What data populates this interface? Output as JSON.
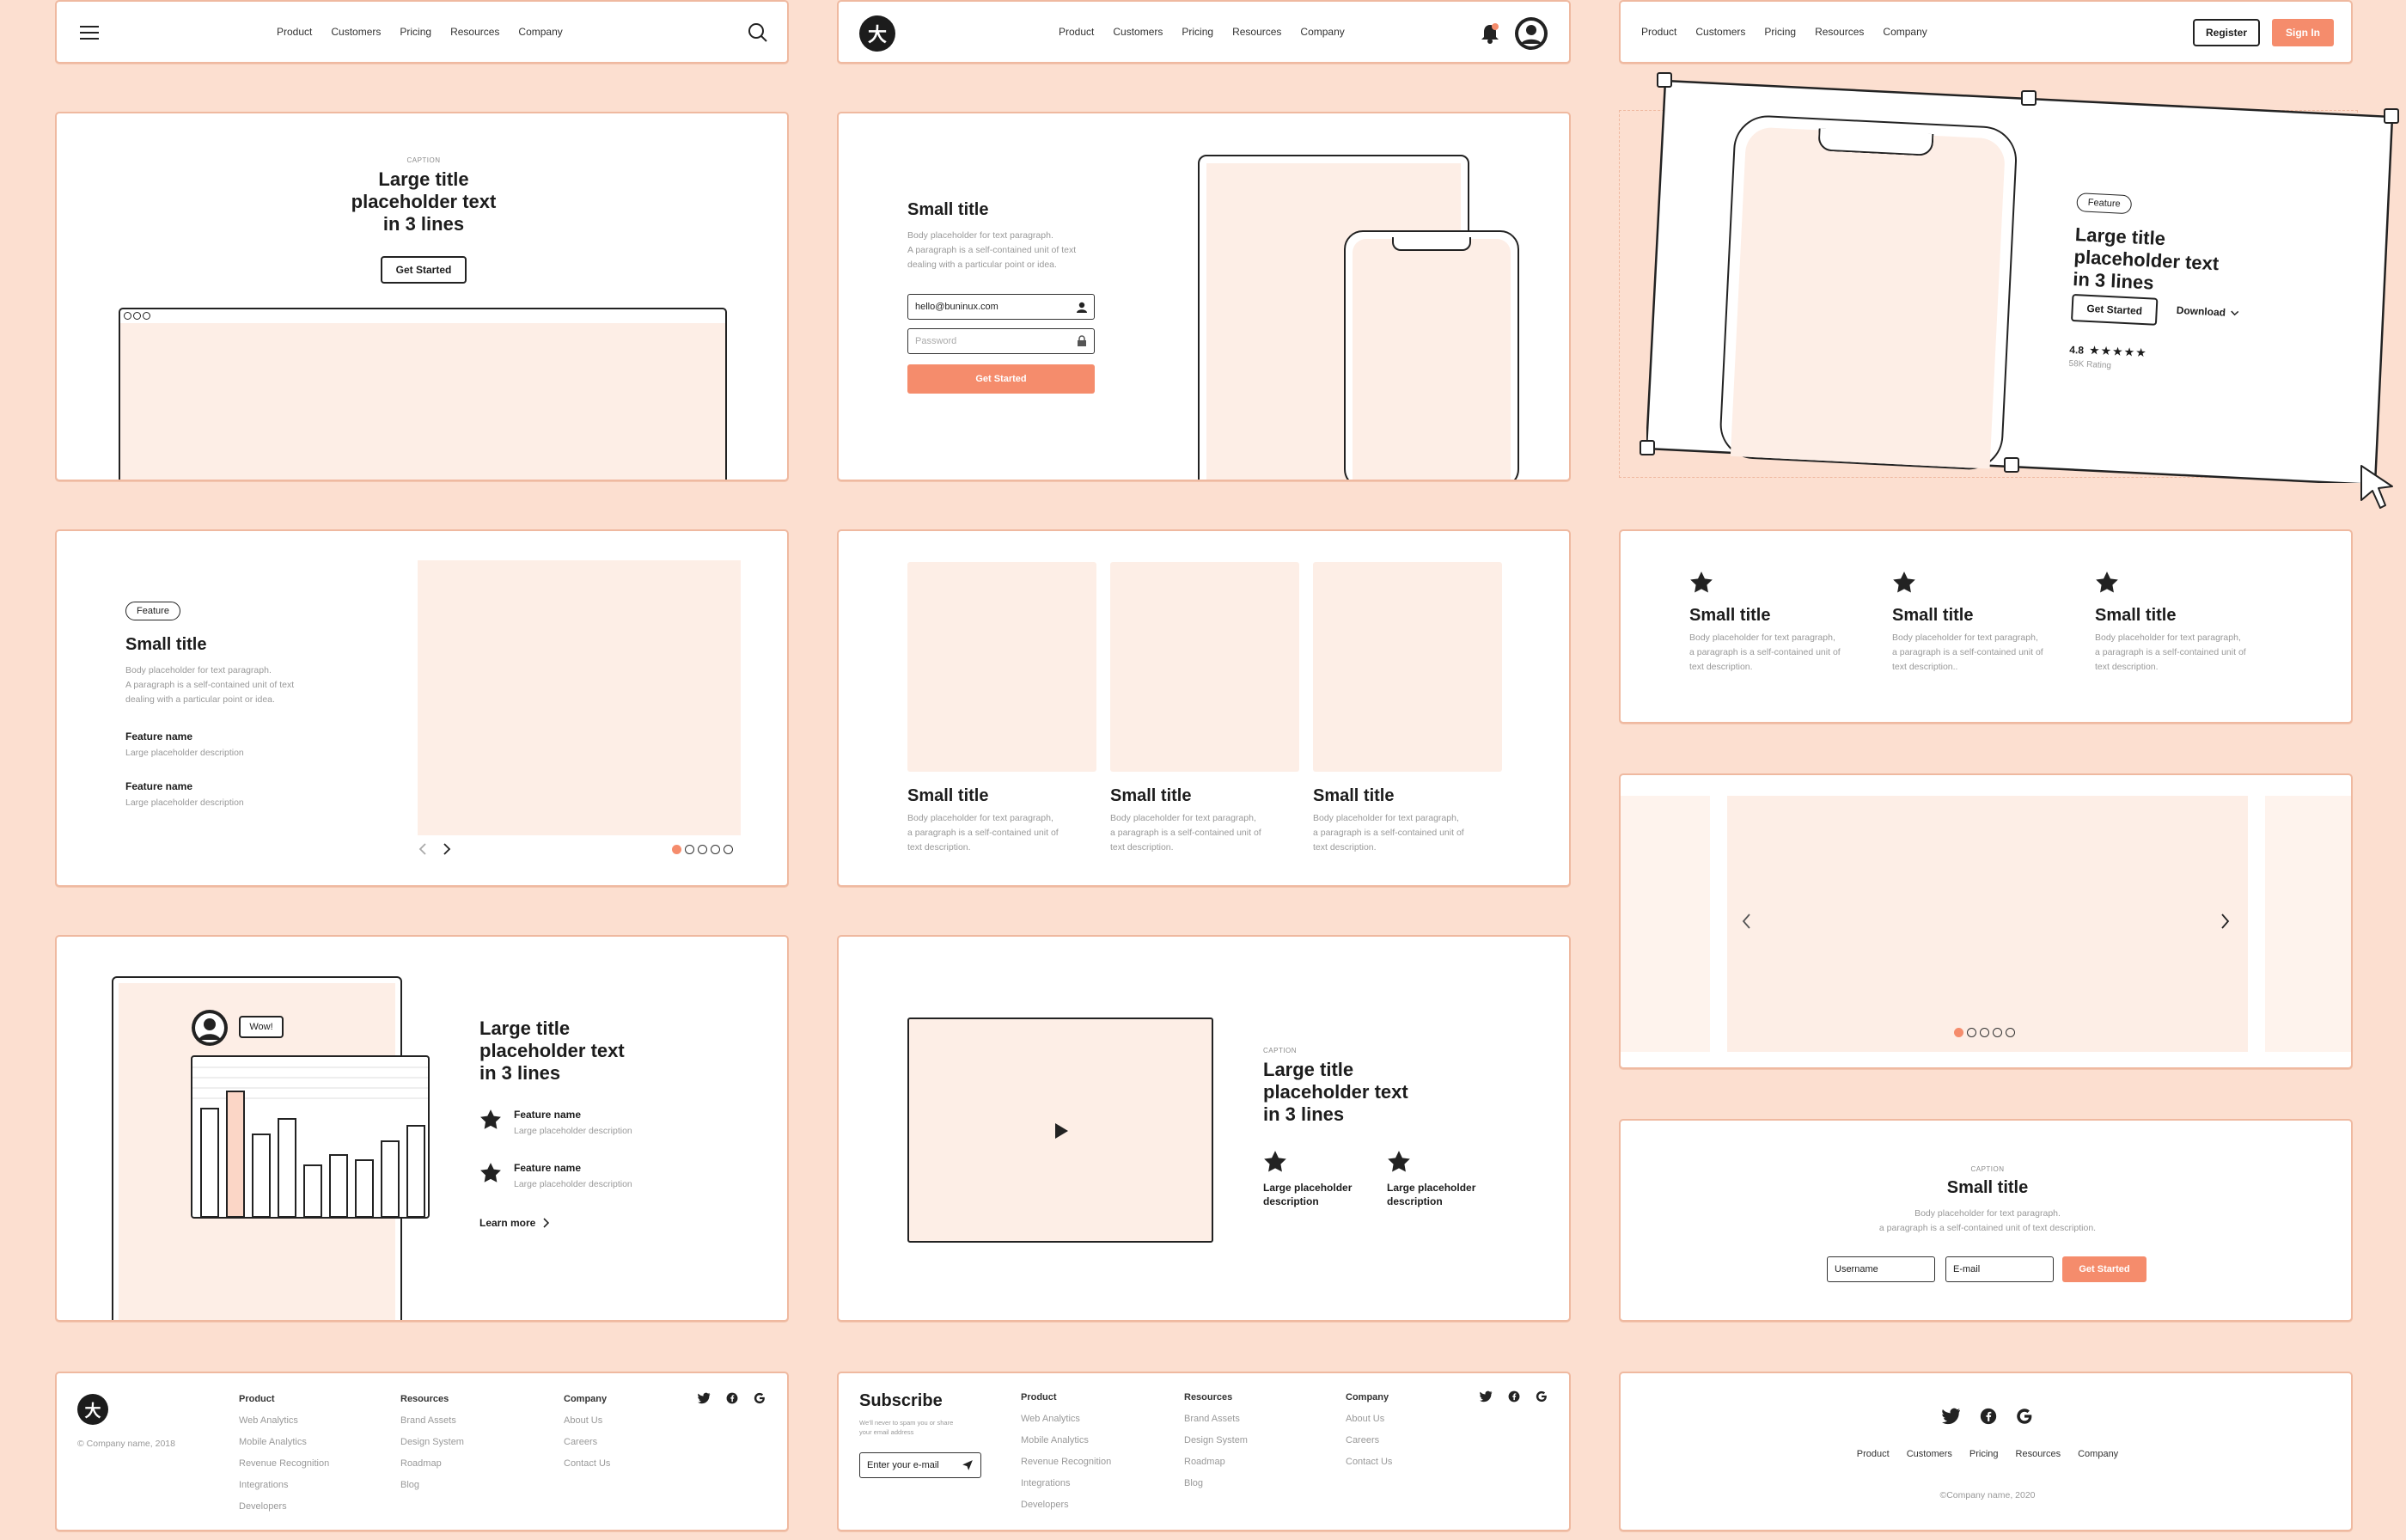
{
  "nav": {
    "links": [
      "Product",
      "Customers",
      "Pricing",
      "Resources",
      "Company"
    ],
    "register": "Register",
    "signin": "Sign In"
  },
  "hero1": {
    "caption": "CAPTION",
    "title": [
      "Large title",
      "placeholder text",
      "in 3 lines"
    ],
    "button": "Get Started"
  },
  "hero2": {
    "title": "Small title",
    "body": [
      "Body placeholder for text paragraph.",
      "A paragraph is a self-contained unit of text",
      "dealing with a particular point or idea."
    ],
    "email": "hello@buninux.com",
    "password_placeholder": "Password",
    "button": "Get Started"
  },
  "hero3": {
    "badge": "Feature",
    "title": [
      "Large title",
      "placeholder text",
      "in 3 lines"
    ],
    "button": "Get Started",
    "download": "Download",
    "rating": "4.8",
    "rating_label": "58K Rating",
    "stars": 5
  },
  "feat1": {
    "badge": "Feature",
    "title": "Small title",
    "body": [
      "Body placeholder for text paragraph.",
      "A paragraph is a self-contained unit of text",
      "dealing with a particular point or idea."
    ],
    "items": [
      {
        "name": "Feature name",
        "desc": "Large placeholder description"
      },
      {
        "name": "Feature name",
        "desc": "Large placeholder description"
      }
    ]
  },
  "cards3": {
    "items": [
      {
        "title": "Small title",
        "body": [
          "Body placeholder for text paragraph,",
          "a paragraph is a self-contained unit of",
          "text description."
        ]
      },
      {
        "title": "Small title",
        "body": [
          "Body placeholder for text paragraph,",
          "a paragraph is a self-contained unit of",
          "text description."
        ]
      },
      {
        "title": "Small title",
        "body": [
          "Body placeholder for text paragraph,",
          "a paragraph is a self-contained unit of",
          "text description."
        ]
      }
    ]
  },
  "icons3": {
    "items": [
      {
        "title": "Small title",
        "body": [
          "Body placeholder for text paragraph,",
          "a paragraph is a self-contained unit of",
          "text description."
        ]
      },
      {
        "title": "Small title",
        "body": [
          "Body placeholder for text paragraph,",
          "a paragraph is a self-contained unit of",
          "text description.."
        ]
      },
      {
        "title": "Small title",
        "body": [
          "Body placeholder for text paragraph,",
          "a paragraph is a self-contained unit of",
          "text description."
        ]
      }
    ]
  },
  "chartcard": {
    "bubble": "Wow!",
    "title": [
      "Large title",
      "placeholder text",
      "in 3 lines"
    ],
    "items": [
      {
        "name": "Feature name",
        "desc": "Large placeholder description"
      },
      {
        "name": "Feature name",
        "desc": "Large placeholder description"
      }
    ],
    "learn": "Learn more"
  },
  "videocard": {
    "caption": "CAPTION",
    "title": [
      "Large title",
      "placeholder text",
      "in 3 lines"
    ],
    "items": [
      [
        "Large placeholder",
        "description"
      ],
      [
        "Large placeholder",
        "description"
      ]
    ]
  },
  "signup": {
    "caption": "CAPTION",
    "title": "Small title",
    "body": [
      "Body placeholder for text paragraph.",
      "a paragraph is a self-contained unit of text description."
    ],
    "username": "Username",
    "email": "E-mail",
    "button": "Get Started"
  },
  "footer1": {
    "copyright": "© Company name, 2018",
    "cols": [
      {
        "head": "Product",
        "links": [
          "Web Analytics",
          "Mobile Analytics",
          "Revenue Recognition",
          "Integrations",
          "Developers"
        ]
      },
      {
        "head": "Resources",
        "links": [
          "Brand Assets",
          "Design System",
          "Roadmap",
          "Blog"
        ]
      },
      {
        "head": "Company",
        "links": [
          "About Us",
          "Careers",
          "Contact Us"
        ]
      }
    ]
  },
  "footer2": {
    "title": "Subscribe",
    "body": [
      "We'll never to spam you or share",
      "your email address"
    ],
    "input": "Enter your e-mail",
    "cols": [
      {
        "head": "Product",
        "links": [
          "Web Analytics",
          "Mobile Analytics",
          "Revenue Recognition",
          "Integrations",
          "Developers"
        ]
      },
      {
        "head": "Resources",
        "links": [
          "Brand Assets",
          "Design System",
          "Roadmap",
          "Blog"
        ]
      },
      {
        "head": "Company",
        "links": [
          "About Us",
          "Careers",
          "Contact Us"
        ]
      }
    ]
  },
  "footer3": {
    "copyright": "©Company name, 2020"
  },
  "colors": {
    "background": "#fcdfd0",
    "accent": "#f58c6c",
    "placeholder": "#fdeee6"
  }
}
